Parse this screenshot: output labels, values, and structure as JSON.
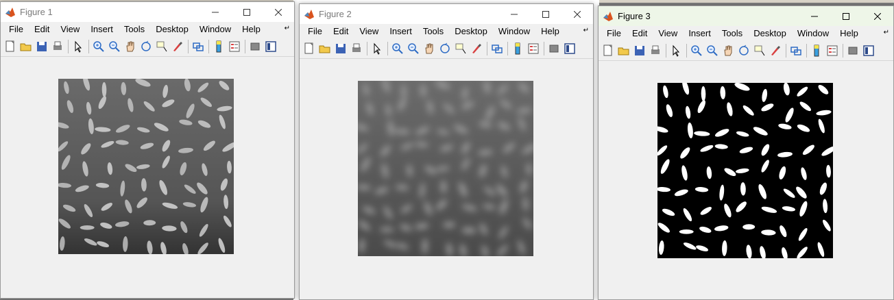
{
  "windows": [
    {
      "title": "Figure 1",
      "image": "rice-grayscale",
      "active": false
    },
    {
      "title": "Figure 2",
      "image": "rice-background-blurred",
      "active": false
    },
    {
      "title": "Figure 3",
      "image": "rice-binary",
      "active": true
    }
  ],
  "menu": [
    "File",
    "Edit",
    "View",
    "Insert",
    "Tools",
    "Desktop",
    "Window",
    "Help"
  ],
  "toolbar_icons": [
    "new-figure-icon",
    "open-file-icon",
    "save-icon",
    "print-icon",
    "edit-plot-icon",
    "zoom-in-icon",
    "zoom-out-icon",
    "pan-icon",
    "rotate-3d-icon",
    "data-cursor-icon",
    "brush-icon",
    "link-plot-icon",
    "colorbar-icon",
    "legend-icon",
    "hide-plot-tools-icon",
    "show-plot-tools-icon"
  ],
  "colors": {
    "titlebar_active": "#eef6e8",
    "window_bg": "#f0f0f0",
    "desktop": "#7f7f7f"
  }
}
